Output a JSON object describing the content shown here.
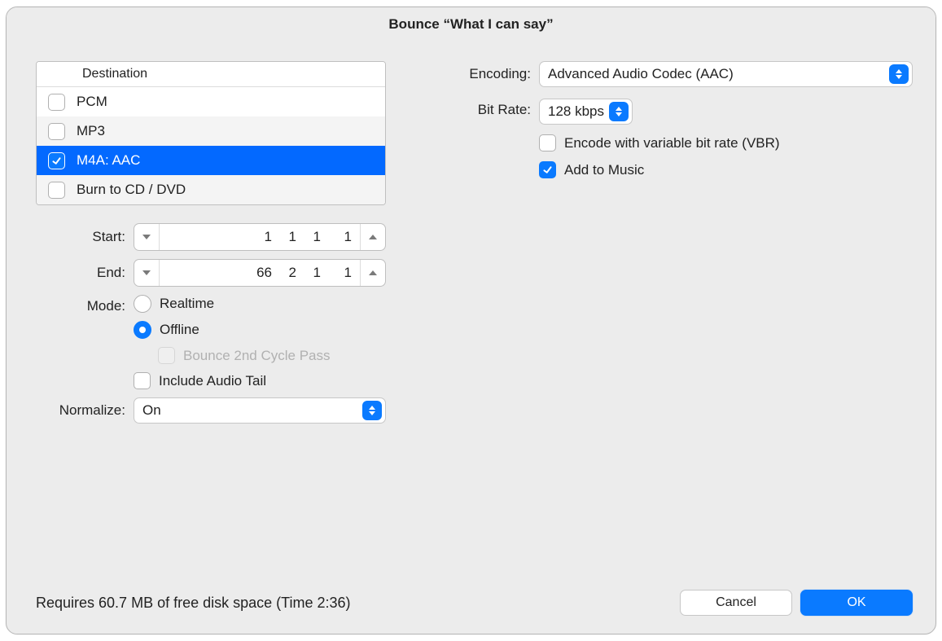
{
  "window": {
    "title": "Bounce “What I can say”"
  },
  "destination": {
    "header": "Destination",
    "items": [
      {
        "label": "PCM",
        "checked": false
      },
      {
        "label": "MP3",
        "checked": false
      },
      {
        "label": "M4A: AAC",
        "checked": true
      },
      {
        "label": "Burn to CD / DVD",
        "checked": false
      }
    ],
    "selected_index": 2
  },
  "range": {
    "start_label": "Start:",
    "end_label": "End:",
    "start": {
      "bar": "1",
      "beat": "1",
      "div": "1",
      "tick": "1"
    },
    "end": {
      "bar": "66",
      "beat": "2",
      "div": "1",
      "tick": "1"
    }
  },
  "mode": {
    "label": "Mode:",
    "options": {
      "realtime": "Realtime",
      "offline": "Offline"
    },
    "selected": "offline",
    "second_pass_label": "Bounce 2nd Cycle Pass",
    "second_pass_enabled": false,
    "include_tail_label": "Include Audio Tail",
    "include_tail_checked": false
  },
  "normalize": {
    "label": "Normalize:",
    "value": "On"
  },
  "encoding": {
    "label": "Encoding:",
    "value": "Advanced Audio Codec (AAC)",
    "bitrate_label": "Bit Rate:",
    "bitrate_value": "128 kbps",
    "vbr_label": "Encode with variable bit rate (VBR)",
    "vbr_checked": false,
    "add_to_music_label": "Add to Music",
    "add_to_music_checked": true
  },
  "footer": {
    "status": "Requires 60.7 MB of free disk space  (Time 2:36)",
    "cancel": "Cancel",
    "ok": "OK"
  }
}
